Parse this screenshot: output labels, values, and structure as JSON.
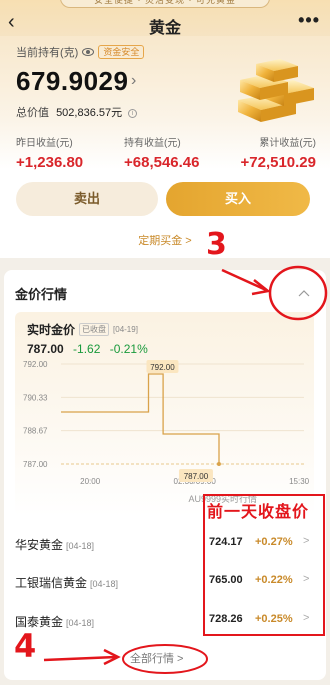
{
  "header": {
    "banner": "安全便捷 · 灵活变现 · 可兑黄金",
    "title": "黄金",
    "back_icon": "‹",
    "more_icon": "•••"
  },
  "holding": {
    "label": "当前持有(克)",
    "badge": "资金安全",
    "amount": "679.9029",
    "amount_arrow": "›",
    "total_label": "总价值",
    "total_value": "502,836.57元",
    "info_icon": "i"
  },
  "stats": [
    {
      "label": "昨日收益(元)",
      "value": "+1,236.80"
    },
    {
      "label": "持有收益(元)",
      "value": "+68,546.46"
    },
    {
      "label": "累计收益(元)",
      "value": "+72,510.29"
    }
  ],
  "actions": {
    "sell": "卖出",
    "buy": "买入",
    "regular": "定期买金 >"
  },
  "annotations": {
    "step3": "3",
    "step4": "4",
    "prev_close_note": "前一天收盘价"
  },
  "market": {
    "title": "金价行情",
    "collapse_icon": "^",
    "realtime_label": "实时金价",
    "closed_badge": "已收盘",
    "date": "[04-19]",
    "price": "787.00",
    "change": "-1.62",
    "change_pct": "-0.21%",
    "chart_source": "AU9999实时行情",
    "all_label": "全部行情 >"
  },
  "chart_data": {
    "type": "line",
    "x_ticks": [
      "20:00",
      "02:30/09:00",
      "15:30"
    ],
    "y_ticks": [
      "792.00",
      "790.33",
      "788.67",
      "787.00"
    ],
    "ylim": [
      787.0,
      792.0
    ],
    "x": [
      0.0,
      0.26,
      0.36,
      0.36,
      0.42,
      0.42,
      0.65,
      0.65
    ],
    "y": [
      789.6,
      789.6,
      789.6,
      791.5,
      791.5,
      788.5,
      788.5,
      787.0
    ],
    "callouts": [
      "792.00",
      "787.00"
    ],
    "color": "#d9a24a"
  },
  "products": [
    {
      "name": "华安黄金",
      "date": "[04-18]",
      "price": "724.17",
      "change": "+0.27%",
      "arrow": ">"
    },
    {
      "name": "工银瑞信黄金",
      "date": "[04-18]",
      "price": "765.00",
      "change": "+0.22%",
      "arrow": ">"
    },
    {
      "name": "国泰黄金",
      "date": "[04-18]",
      "price": "728.26",
      "change": "+0.25%",
      "arrow": ">"
    }
  ]
}
